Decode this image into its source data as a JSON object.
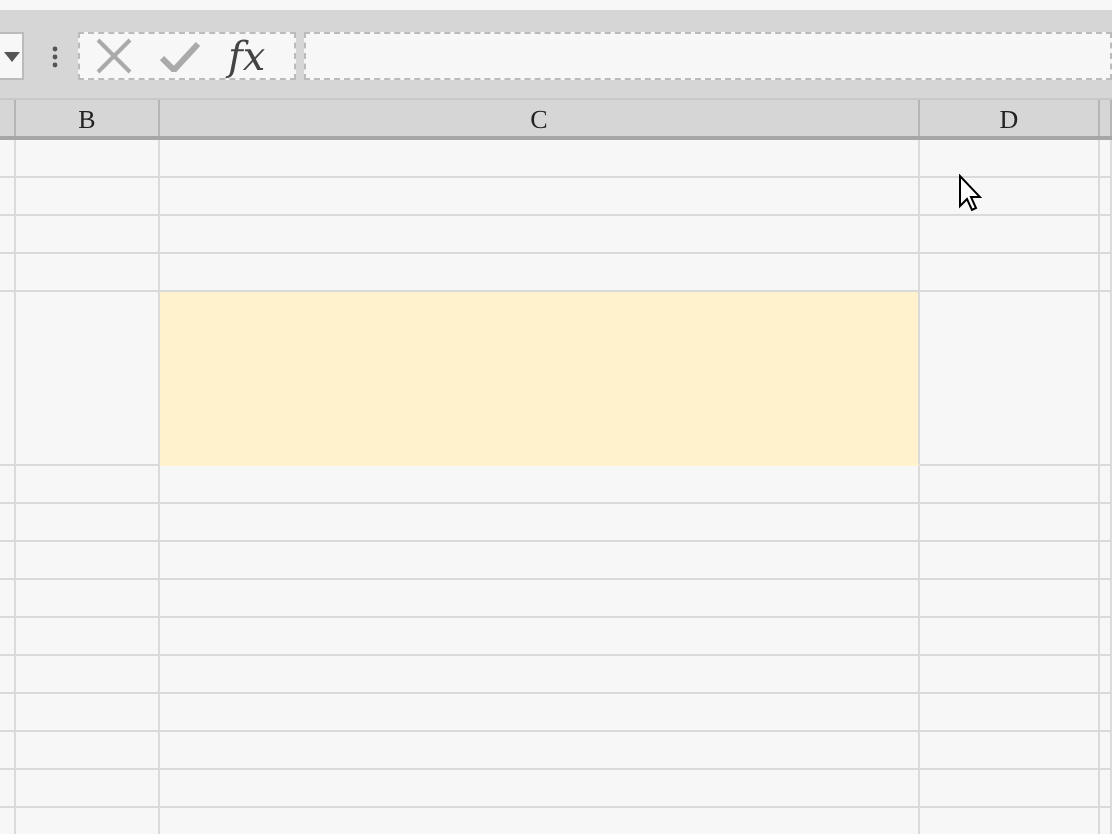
{
  "formula_bar": {
    "fx_label": "fx"
  },
  "columns": [
    {
      "label": "B"
    },
    {
      "label": "C"
    },
    {
      "label": "D"
    }
  ],
  "rows": [
    {
      "filled": false
    },
    {
      "filled": false
    },
    {
      "filled": false
    },
    {
      "filled": false
    },
    {
      "filled": true
    },
    {
      "filled": false
    },
    {
      "filled": false
    },
    {
      "filled": false
    },
    {
      "filled": false
    },
    {
      "filled": false
    },
    {
      "filled": false
    },
    {
      "filled": false
    },
    {
      "filled": false
    },
    {
      "filled": false
    },
    {
      "filled": false
    }
  ]
}
